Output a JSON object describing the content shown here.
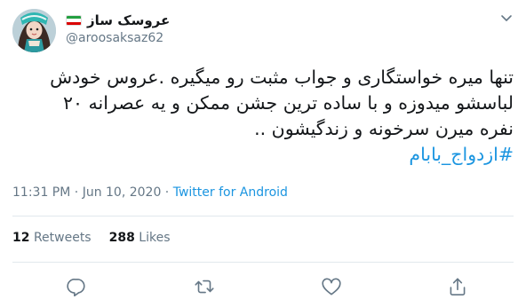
{
  "user": {
    "name": "عروسک ساز",
    "handle": "@aroosaksaz62"
  },
  "tweet": {
    "lines": [
      "تنها میره خواستگاری و جواب مثبت رو میگیره .عروس خودش",
      "لباسشو میدوزه و با ساده ترین جشن ممکن و یه عصرانه ۲۰",
      "نفره میرن سرخونه و زندگیشون .."
    ],
    "hashtag": "#ازدواج_بابام"
  },
  "meta": {
    "time": "11:31 PM",
    "separator1": " · ",
    "date": "Jun 10, 2020",
    "separator2": " · ",
    "source": "Twitter for Android"
  },
  "stats": {
    "retweets_count": "12",
    "retweets_label": "Retweets",
    "likes_count": "288",
    "likes_label": "Likes"
  },
  "colors": {
    "link": "#1b95e0",
    "secondary": "#657786",
    "divider": "#e1e8ed",
    "flag_green": "#239f40",
    "flag_red": "#da0000"
  },
  "icons": [
    "avatar",
    "iran-flag-icon",
    "chevron-down-icon",
    "reply-icon",
    "retweet-icon",
    "like-icon",
    "share-icon"
  ]
}
